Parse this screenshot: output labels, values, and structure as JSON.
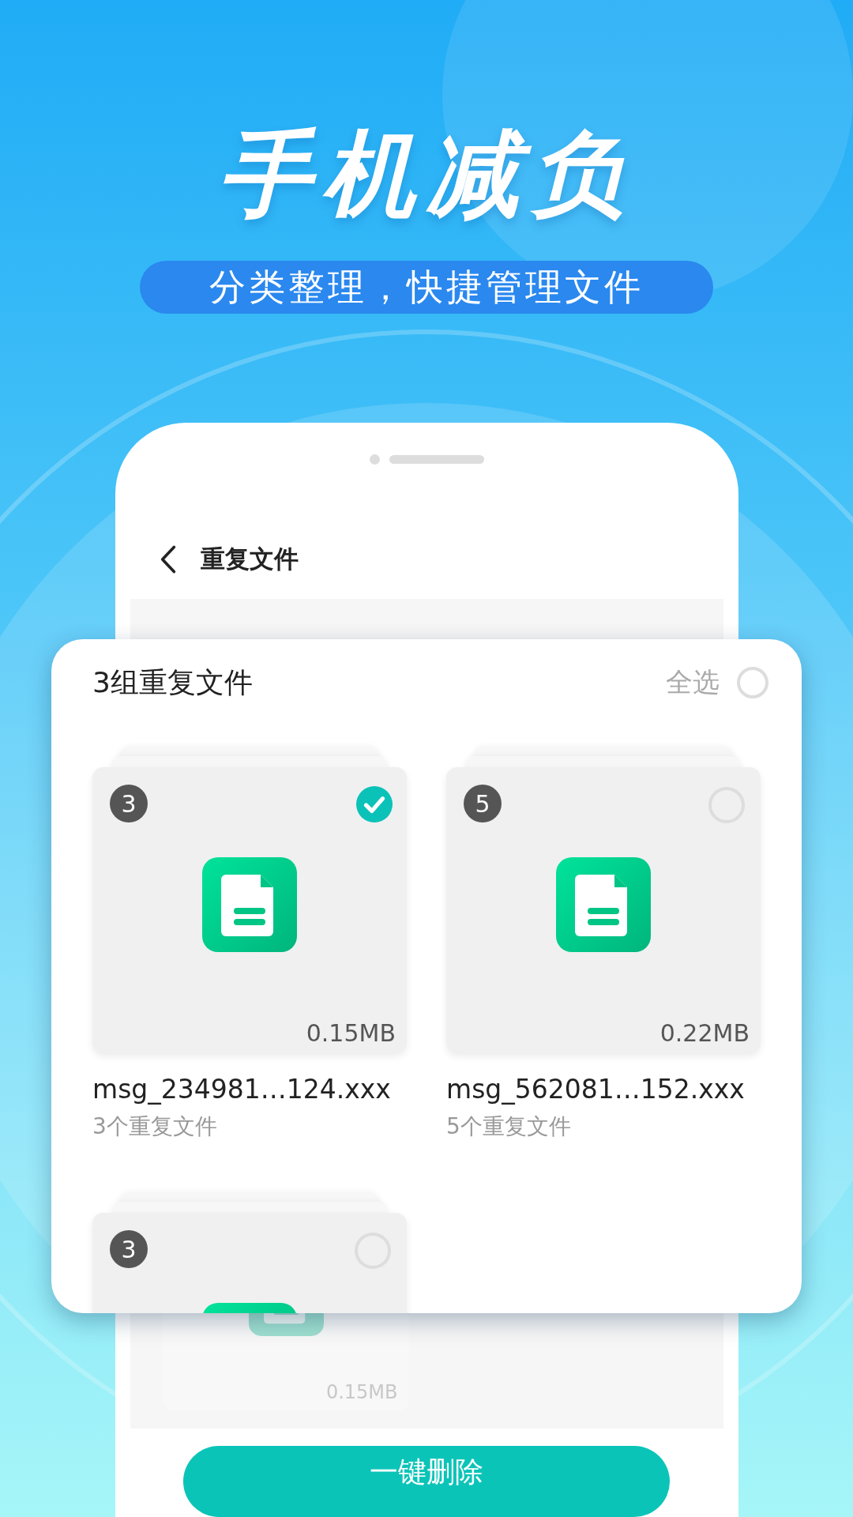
{
  "banner": {
    "title": "手机减负",
    "subtitle": "分类整理，快捷管理文件"
  },
  "phone": {
    "title": "重复文件",
    "underlay_size": "0.15MB",
    "button": "一键删除"
  },
  "panel": {
    "heading": "3组重复文件",
    "select_all": {
      "label": "全选",
      "checked": false
    },
    "groups": [
      {
        "count": "3",
        "selected": true,
        "size": "0.15MB",
        "name": "msg_234981…124.xxx",
        "subtitle": "3个重复文件"
      },
      {
        "count": "5",
        "selected": false,
        "size": "0.22MB",
        "name": "msg_562081…152.xxx",
        "subtitle": "5个重复文件"
      },
      {
        "count": "3",
        "selected": false
      }
    ]
  }
}
